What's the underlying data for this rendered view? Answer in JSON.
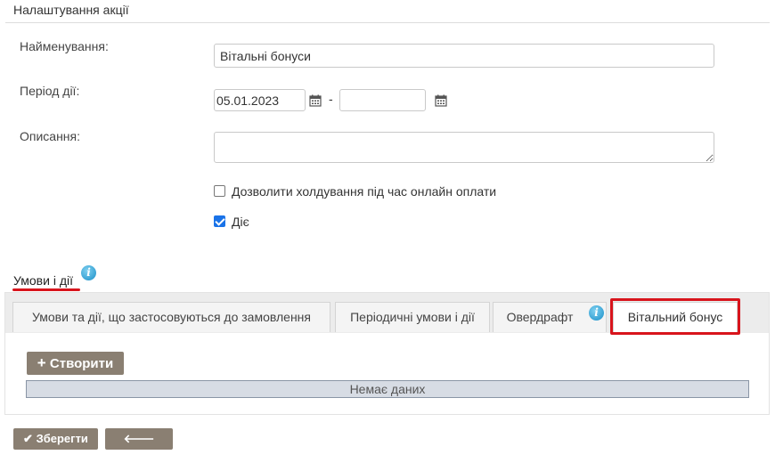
{
  "section_title": "Налаштування акції",
  "form": {
    "name_label": "Найменування:",
    "name_value": "Вітальні бонуси",
    "period_label": "Період дії:",
    "period_start": "05.01.2023",
    "period_end": "",
    "period_separator": "-",
    "description_label": "Описання:",
    "description_value": "",
    "allow_hold_label": "Дозволити холдування під час онлайн оплати",
    "allow_hold_checked": false,
    "active_label": "Діє",
    "active_checked": true
  },
  "conditions": {
    "title": "Умови і дії",
    "tabs": [
      {
        "label": "Умови та дії, що застосовуються до замовлення",
        "active": false
      },
      {
        "label": "Періодичні умови і дії",
        "active": false
      },
      {
        "label": "Овердрафт",
        "active": false
      },
      {
        "label": "Вітальний бонус",
        "active": true
      }
    ],
    "create_button": "Створити",
    "empty_text": "Немає даних"
  },
  "footer": {
    "save_button": "Зберегти",
    "back_button": "Назад"
  },
  "colors": {
    "highlight": "#d8141c",
    "underline": "#d8141c",
    "button": "#8a7f72",
    "checkbox": "#1a73e8"
  }
}
